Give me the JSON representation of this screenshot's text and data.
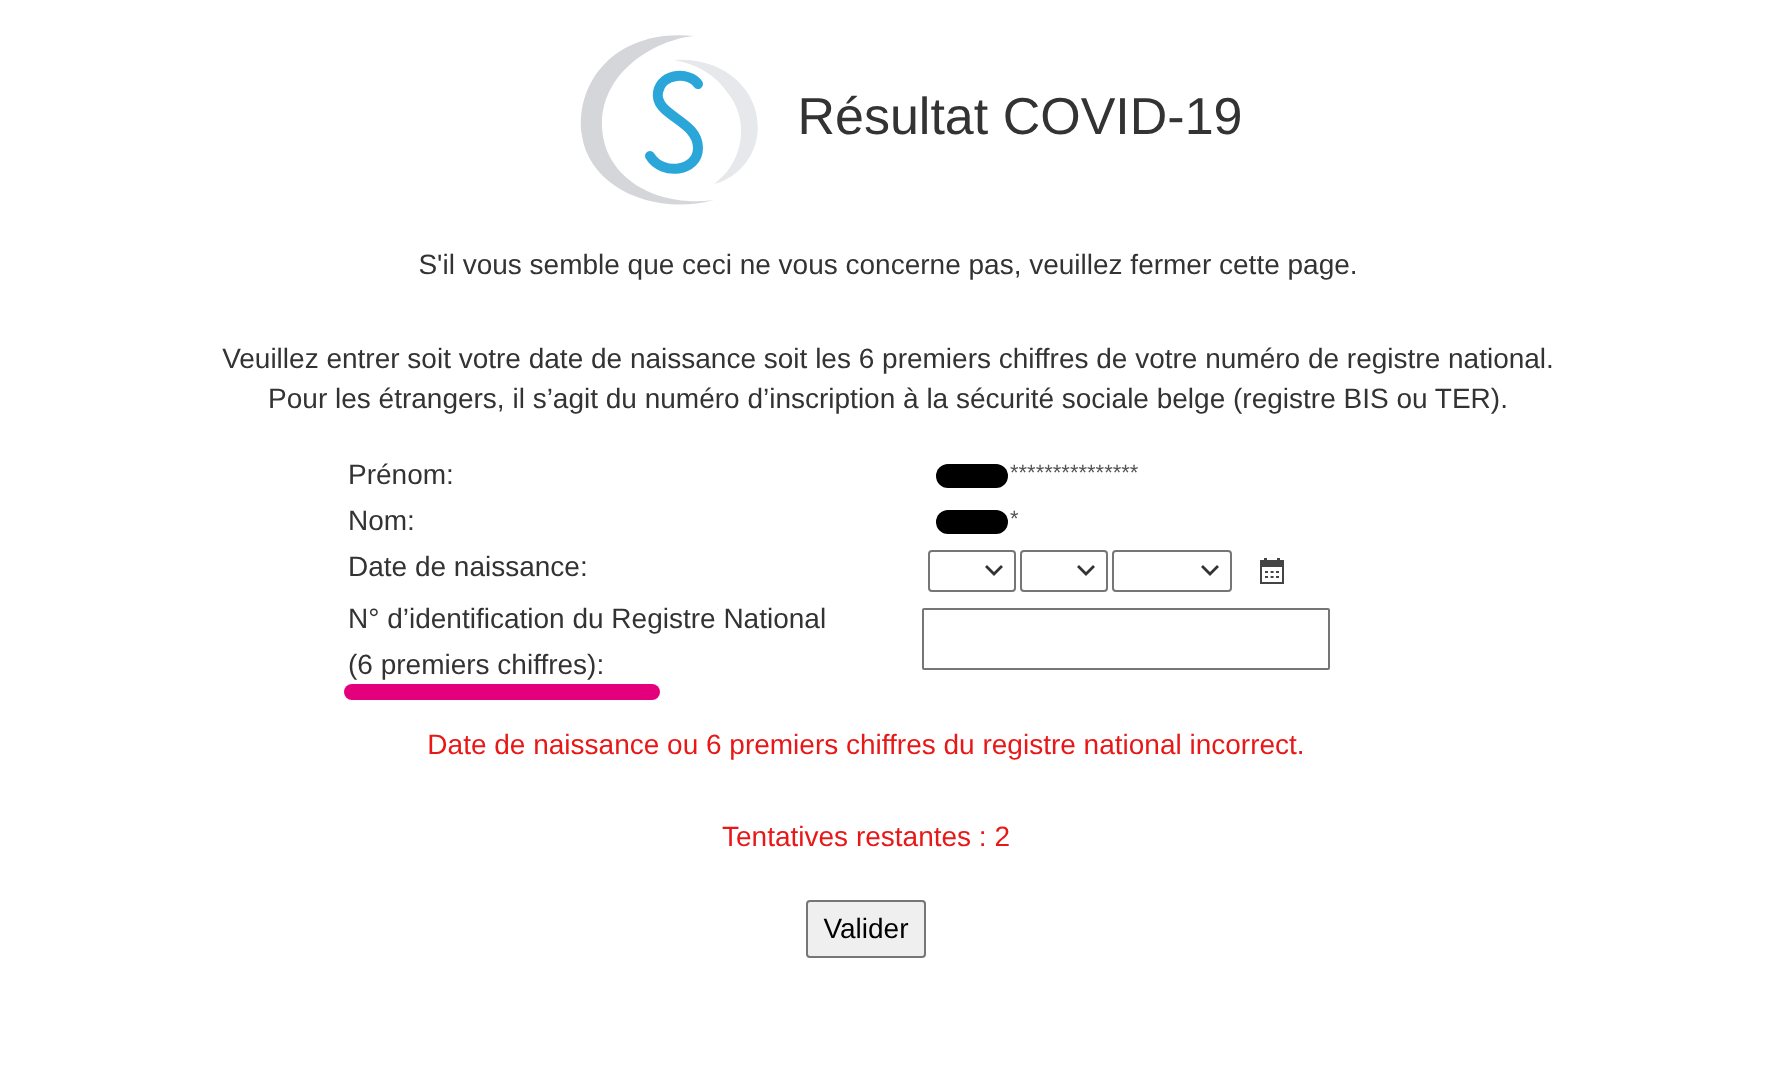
{
  "header": {
    "title": "Résultat COVID-19"
  },
  "notice": "S'il vous semble que ceci ne vous concerne pas, veuillez fermer cette page.",
  "instructions": [
    "Veuillez entrer soit votre date de naissance soit les 6 premiers chiffres de votre numéro de registre national.",
    "Pour les étrangers, il s’agit du numéro d’inscription à la sécurité sociale belge (registre BIS ou TER)."
  ],
  "form": {
    "rows": [
      {
        "kind": "text",
        "label": "Prénom:",
        "value": "***************",
        "redacted": true
      },
      {
        "kind": "text",
        "label": "Nom:",
        "value": "*",
        "redacted": true
      },
      {
        "kind": "date",
        "label": "Date de naissance:"
      },
      {
        "kind": "input",
        "label": "N° d’identification du Registre National",
        "label_line_2": "(6 premiers chiffres):",
        "highlighted": true
      }
    ]
  },
  "error": "Date de naissance ou 6 premiers chiffres du registre national incorrect.",
  "attempts": "Tentatives restantes : 2",
  "submit": "Valider"
}
